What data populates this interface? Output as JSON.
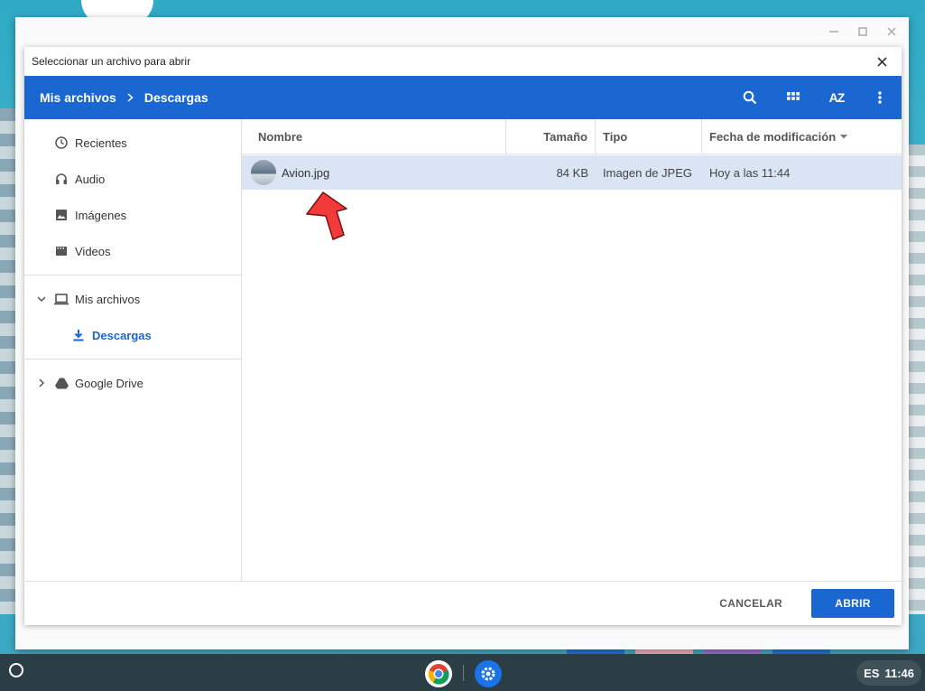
{
  "colors": {
    "accent": "#1a67d2",
    "selected_row": "#dbe4f4",
    "shelf": "#2c3e45",
    "arrow": "#f23a3a"
  },
  "outer_window": {
    "controls": [
      "minimize-icon",
      "maximize-icon",
      "close-icon"
    ]
  },
  "dialog": {
    "title": "Seleccionar un archivo para abrir",
    "breadcrumb": {
      "root": "Mis archivos",
      "current": "Descargas"
    },
    "toolbar_icons": [
      "search-icon",
      "grid-view-icon",
      "sort-az-icon",
      "more-vert-icon"
    ],
    "sort_label": "AZ",
    "nav": {
      "recent_group": [
        {
          "label": "Recientes",
          "icon": "clock-icon"
        },
        {
          "label": "Audio",
          "icon": "headphones-icon"
        },
        {
          "label": "Imágenes",
          "icon": "image-icon"
        },
        {
          "label": "Videos",
          "icon": "film-icon"
        }
      ],
      "my_files": {
        "label": "Mis archivos",
        "icon": "laptop-icon",
        "child": {
          "label": "Descargas",
          "icon": "download-icon"
        }
      },
      "drive": {
        "label": "Google Drive",
        "icon": "drive-icon"
      }
    },
    "table": {
      "headers": {
        "name": "Nombre",
        "size": "Tamaño",
        "type": "Tipo",
        "date": "Fecha de modificación"
      },
      "rows": [
        {
          "name": "Avion.jpg",
          "size": "84 KB",
          "type": "Imagen de JPEG",
          "date": "Hoy a las 11:44"
        }
      ]
    },
    "footer": {
      "cancel": "CANCELAR",
      "open": "ABRIR"
    }
  },
  "shelf": {
    "language": "ES",
    "time": "11:46"
  }
}
